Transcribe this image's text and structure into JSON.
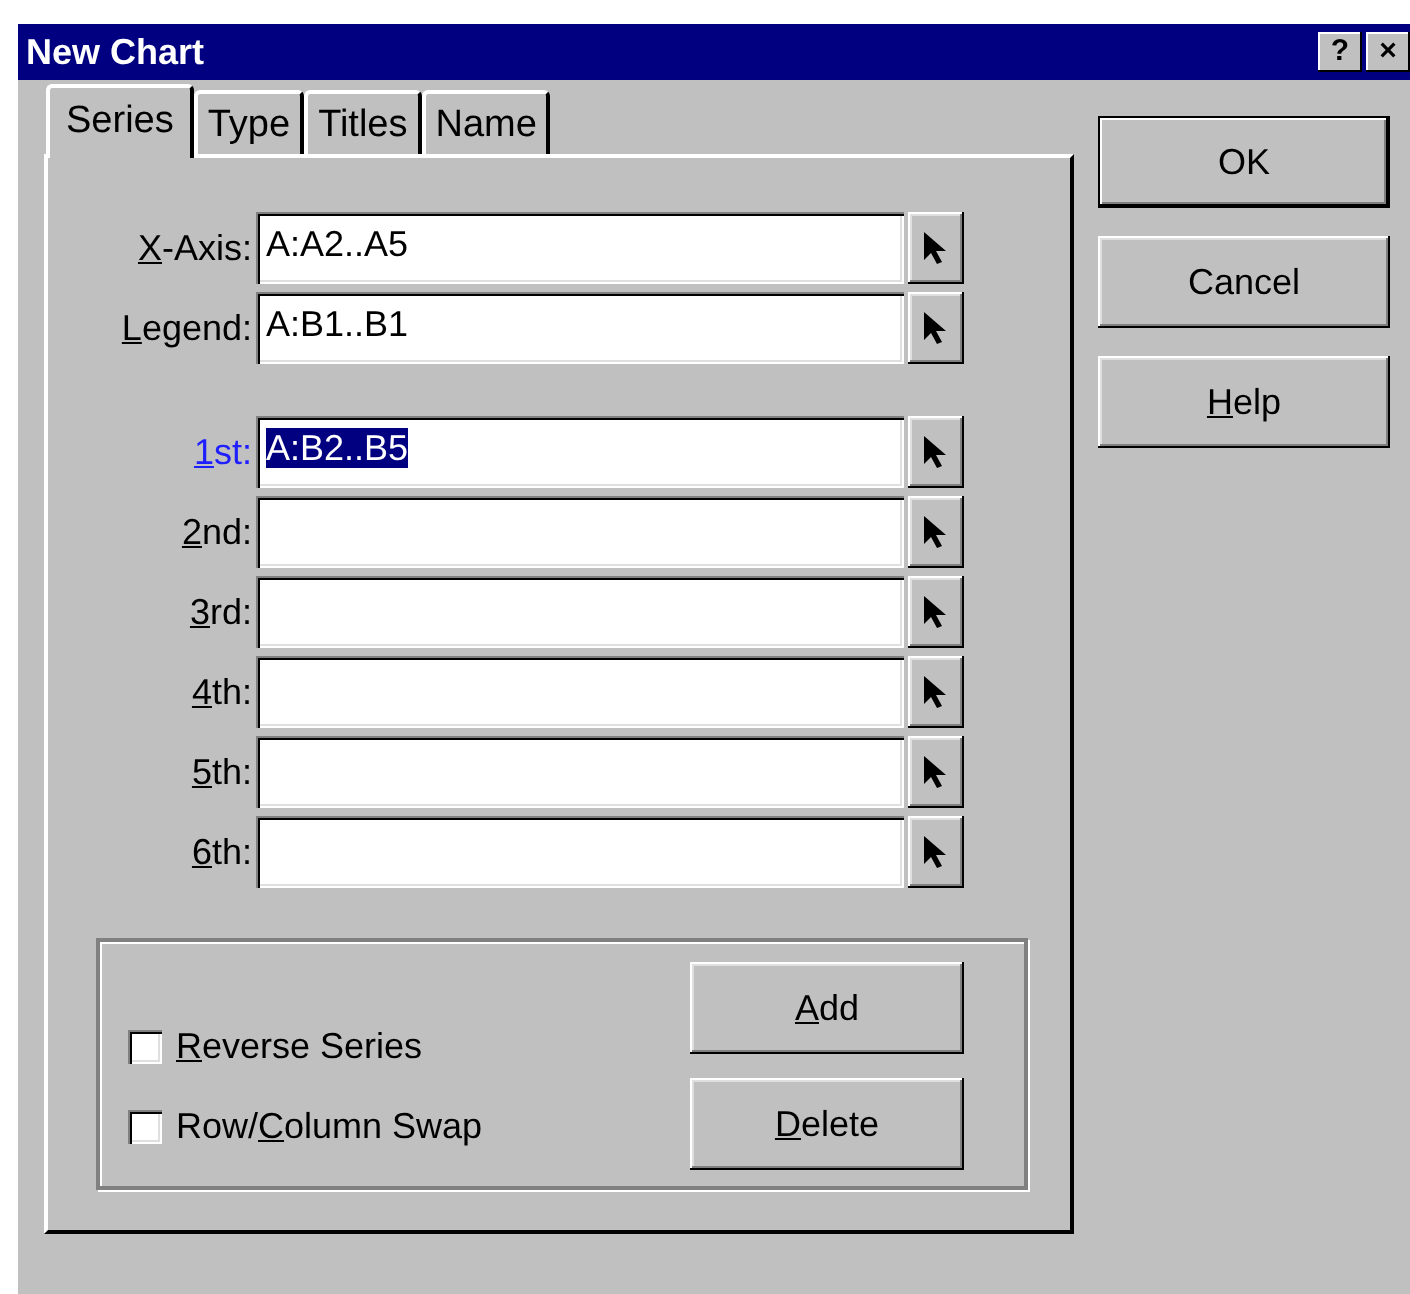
{
  "window": {
    "title": "New Chart",
    "title_buttons": [
      "?",
      "×"
    ]
  },
  "tabs": [
    {
      "label": "Series",
      "selected": true
    },
    {
      "label": "Type",
      "selected": false
    },
    {
      "label": "Titles",
      "selected": false
    },
    {
      "label": "Name",
      "selected": false
    }
  ],
  "ranges": [
    {
      "mnemonic": "X",
      "label_rest": "-Axis:",
      "value": "A:A2..A5"
    },
    {
      "mnemonic": "L",
      "label_rest": "egend:",
      "value": "A:B1..B1"
    }
  ],
  "series": [
    {
      "mnemonic": "1",
      "label_rest": "st:",
      "value": "A:B2..B5",
      "focused": true
    },
    {
      "mnemonic": "2",
      "label_rest": "nd:",
      "focused": false
    },
    {
      "mnemonic": "3",
      "label_rest": "rd:",
      "focused": false
    },
    {
      "mnemonic": "4",
      "label_rest": "th:",
      "focused": false
    },
    {
      "mnemonic": "5",
      "label_rest": "th:",
      "focused": false
    },
    {
      "mnemonic": "6",
      "label_rest": "th:",
      "focused": false
    }
  ],
  "options": [
    {
      "mnemonic": "R",
      "label_rest": "everse Series",
      "checked": false
    },
    {
      "label_before": "Row/",
      "mnemonic": "C",
      "label_rest": "olumn Swap",
      "checked": false
    }
  ],
  "series_buttons": [
    {
      "mnemonic": "A",
      "label_rest": "dd"
    },
    {
      "mnemonic": "D",
      "label_rest": "elete"
    }
  ],
  "dialog_buttons": [
    {
      "label_rest": "OK",
      "default": true
    },
    {
      "label_rest": "Cancel",
      "default": false
    },
    {
      "mnemonic": "H",
      "label_rest": "elp",
      "default": false
    }
  ]
}
